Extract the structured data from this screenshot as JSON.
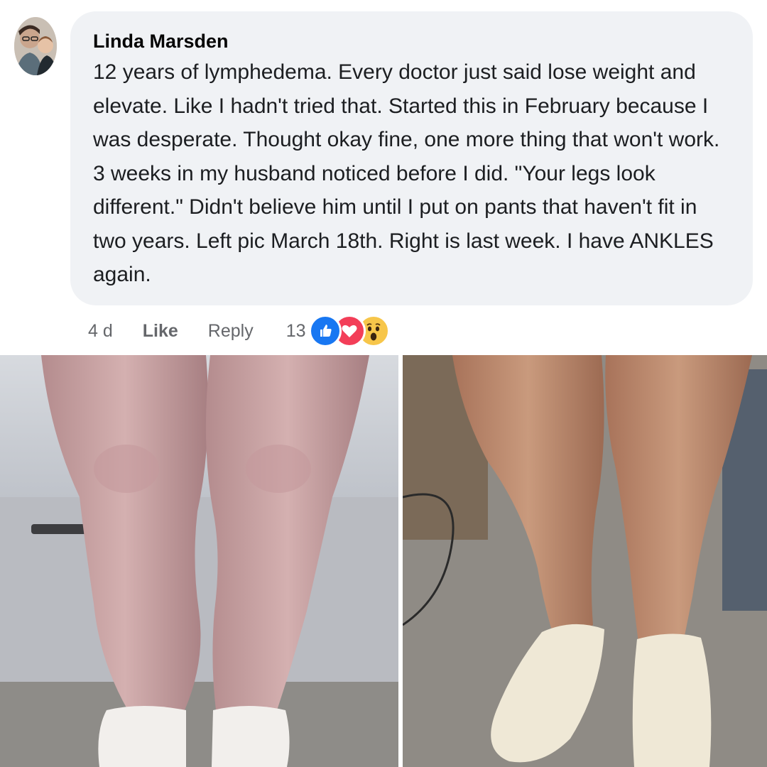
{
  "comment": {
    "author": "Linda Marsden",
    "text": "12 years of lymphedema. Every doctor just said lose weight and elevate. Like I hadn't tried that. Started this in February because I was desperate. Thought okay fine, one more thing that won't work. 3 weeks in my husband noticed before I did. \"Your legs look different.\" Didn't believe him until I put on pants that haven't fit in two years. Left pic March 18th. Right is last week. I have ANKLES again.",
    "time": "4 d",
    "like_label": "Like",
    "reply_label": "Reply",
    "reaction_count": "13",
    "reactions": [
      "like-icon",
      "love-icon",
      "wow-icon"
    ]
  },
  "colors": {
    "bubble": "#f0f2f5",
    "meta_text": "#65676b",
    "like_blue": "#1877f2",
    "love_red": "#f33e58",
    "wow_yellow": "#f7c64a"
  }
}
